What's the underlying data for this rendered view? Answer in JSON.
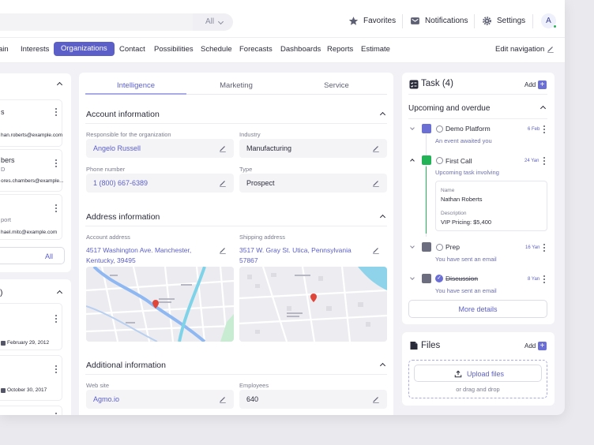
{
  "topbar": {
    "scope_select": "All",
    "favorites": "Favorites",
    "notifications": "Notifications",
    "settings": "Settings",
    "avatar_initial": "A"
  },
  "nav": {
    "items": [
      "ain",
      "Interests",
      "Organizations",
      "Contact",
      "Possibilities",
      "Schedule",
      "Forecasts",
      "Dashboards",
      "Reports",
      "Estimate"
    ],
    "edit_navigation": "Edit navigation"
  },
  "left_panel": {
    "contacts": [
      {
        "name": "s",
        "detail": "",
        "email": "han.roberts@example.com"
      },
      {
        "name": "bers",
        "detail": "D",
        "email": "ores.chambers@example..."
      },
      {
        "name": "",
        "detail": "port",
        "email": "hael.mitc@example.com"
      }
    ],
    "view_all": "All",
    "second_title": ")",
    "dates": [
      "February 29, 2012",
      "October 30, 2017"
    ]
  },
  "main": {
    "tabs": [
      "Intelligence",
      "Marketing",
      "Service"
    ],
    "account": {
      "title": "Account information",
      "responsible_label": "Responsible for the organization",
      "responsible_value": "Angelo Russell",
      "industry_label": "Industry",
      "industry_value": "Manufacturing",
      "phone_label": "Phone number",
      "phone_value": "1 (800) 667-6389",
      "type_label": "Type",
      "type_value": "Prospect"
    },
    "address": {
      "title": "Address information",
      "account_label": "Account address",
      "account_line1": "4517 Washington Ave. Manchester,",
      "account_line2": "Kentucky, 39495",
      "shipping_label": "Shipping address",
      "shipping_line1": "3517 W. Gray St. Utica, Pennsylvania",
      "shipping_line2": "57867"
    },
    "additional": {
      "title": "Additional  information",
      "website_label": "Web site",
      "website_value": "Agmo.io",
      "employees_label": "Employees",
      "employees_value": "640"
    }
  },
  "tasks": {
    "title": "Task (4)",
    "add": "Add",
    "section": "Upcoming and overdue",
    "items": [
      {
        "title": "Demo Platform",
        "date": "6 Feb",
        "sub": "An event awaited you"
      },
      {
        "title": "First Call",
        "date": "24 Yan",
        "sub": "Upcoming task involving"
      },
      {
        "title": "Prep",
        "date": "16 Yan",
        "sub": "You have sent an email"
      },
      {
        "title": "Discussion",
        "date": "8 Yan",
        "sub": "You have sent an email"
      }
    ],
    "detail": {
      "name_label": "Name",
      "name_value": "Nathan Roberts",
      "desc_label": "Description",
      "desc_value": "VIP Pricing: $5,400"
    },
    "more": "More details"
  },
  "files": {
    "title": "Files",
    "add": "Add",
    "upload": "Upload files",
    "hint": "or drag and drop"
  },
  "colors": {
    "accent": "#5b5fc7",
    "success": "#22b357"
  }
}
